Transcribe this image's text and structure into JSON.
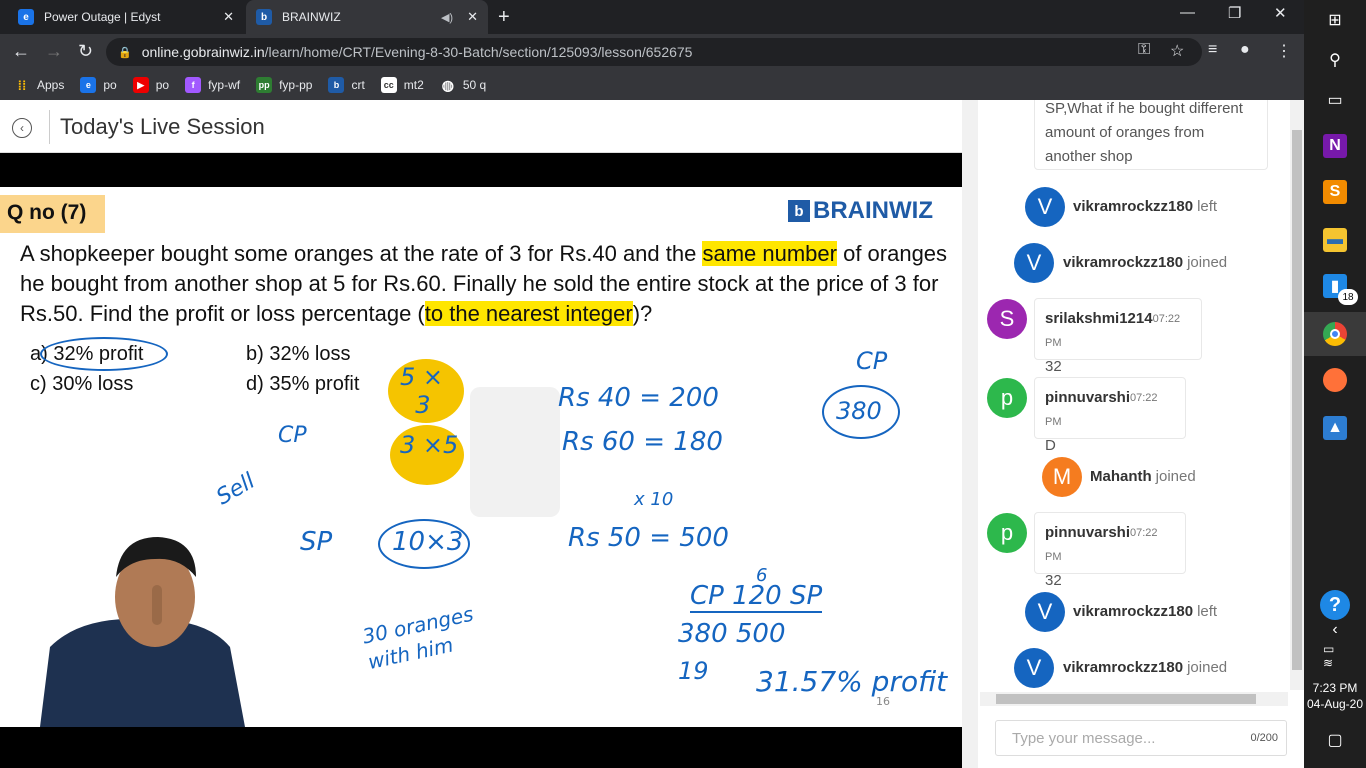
{
  "browser": {
    "tabs": [
      {
        "title": "Power Outage | Edyst",
        "favicon": "edyst-icon"
      },
      {
        "title": "BRAINWIZ",
        "favicon": "brainwiz-icon"
      }
    ],
    "new_tab": "+",
    "url_host": "online.gobrainwiz.in",
    "url_path": "/learn/home/CRT/Evening-8-30-Batch/section/125093/lesson/652675",
    "bookmarks": [
      "Apps",
      "po",
      "po",
      "fyp-wf",
      "fyp-pp",
      "crt",
      "mt2",
      "50 q"
    ]
  },
  "page": {
    "title": "Today's Live Session"
  },
  "slide": {
    "qno": "Q no (7)",
    "brand": "BRAINWIZ",
    "question_part1": "A shopkeeper bought some oranges at the rate of 3 for Rs.40 and the ",
    "question_hl1": "same number",
    "question_part2": " of oranges he bought from another shop at 5 for Rs.60. Finally he sold the entire stock at the price of 3 for Rs.50. Find the profit or loss percentage (",
    "question_hl2": "to the nearest integer",
    "question_part3": ")?",
    "options": {
      "a": "a) 32% profit",
      "b": "b)  32% loss",
      "c": "c) 30% loss",
      "d": "d) 35% profit"
    },
    "ink": {
      "cp_label": "CP",
      "cp_top": "CP",
      "cp_total": "380",
      "row1": "Rs  40   =  200",
      "row2": "Rs  60   = 180",
      "sell": "Sell",
      "sp_label": "SP",
      "sp_row": "Rs  50    =  500",
      "x10": "x 10",
      "oranges_note": "30 oranges with him",
      "fraction_top": "CP  120  SP",
      "fraction_bottom": "380       500",
      "six": "6",
      "nineteen": "19",
      "result": "31.57% profit",
      "page_no": "16"
    }
  },
  "chat": {
    "messages": [
      {
        "type": "msg-partial",
        "text": "SP,What if he bought different amount of oranges from another shop"
      },
      {
        "type": "event",
        "user": "vikramrockzz180",
        "event": "left",
        "avatar": "V",
        "color": "#1565c0"
      },
      {
        "type": "event",
        "user": "vikramrockzz180",
        "event": "joined",
        "avatar": "V",
        "color": "#1565c0"
      },
      {
        "type": "msg",
        "user": "srilakshmi1214",
        "time": "07:22 PM",
        "text": "32",
        "avatar": "S",
        "color": "#9c27b0"
      },
      {
        "type": "msg",
        "user": "pinnuvarshi",
        "time": "07:22 PM",
        "text": "D",
        "avatar": "p",
        "color": "#2db84c"
      },
      {
        "type": "event",
        "user": "Mahanth",
        "event": "joined",
        "avatar": "M",
        "color": "#f57c1f"
      },
      {
        "type": "msg",
        "user": "pinnuvarshi",
        "time": "07:22 PM",
        "text": "32",
        "avatar": "p",
        "color": "#2db84c"
      },
      {
        "type": "event",
        "user": "vikramrockzz180",
        "event": "left",
        "avatar": "V",
        "color": "#1565c0"
      },
      {
        "type": "event",
        "user": "vikramrockzz180",
        "event": "joined",
        "avatar": "V",
        "color": "#1565c0"
      }
    ],
    "input_placeholder": "Type your message...",
    "counter": "0/200"
  },
  "taskbar": {
    "badge": "18",
    "time": "7:23 PM",
    "date": "04-Aug-20"
  }
}
